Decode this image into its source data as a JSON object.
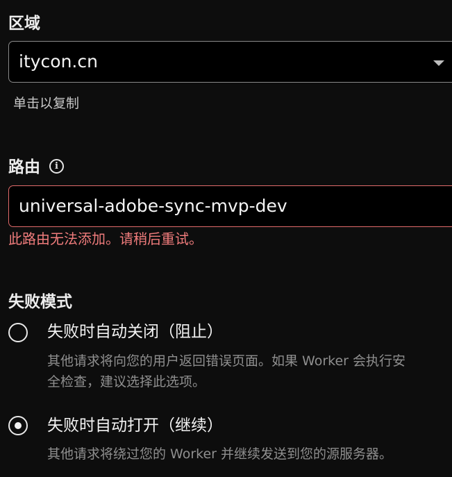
{
  "region": {
    "label": "区域",
    "selected": "itycon.cn",
    "helper": "单击以复制"
  },
  "route": {
    "label": "路由",
    "info_icon": "info-icon",
    "value": "universal-adobe-sync-mvp-dev",
    "error": "此路由无法添加。请稍后重试。"
  },
  "failure_mode": {
    "label": "失败模式",
    "options": [
      {
        "title": "失败时自动关闭（阻止）",
        "desc_line1": "其他请求将向您的用户返回错误页面。如果 Worker 会执行安",
        "desc_line2": "全检查，建议选择此选项。",
        "selected": false
      },
      {
        "title": "失败时自动打开（继续）",
        "desc_line1": "其他请求将绕过您的 Worker 并继续发送到您的源服务器。",
        "selected": true
      }
    ]
  },
  "colors": {
    "background": "#0d0d0d",
    "error": "#f07c7c",
    "error_border": "#e26b6b"
  }
}
